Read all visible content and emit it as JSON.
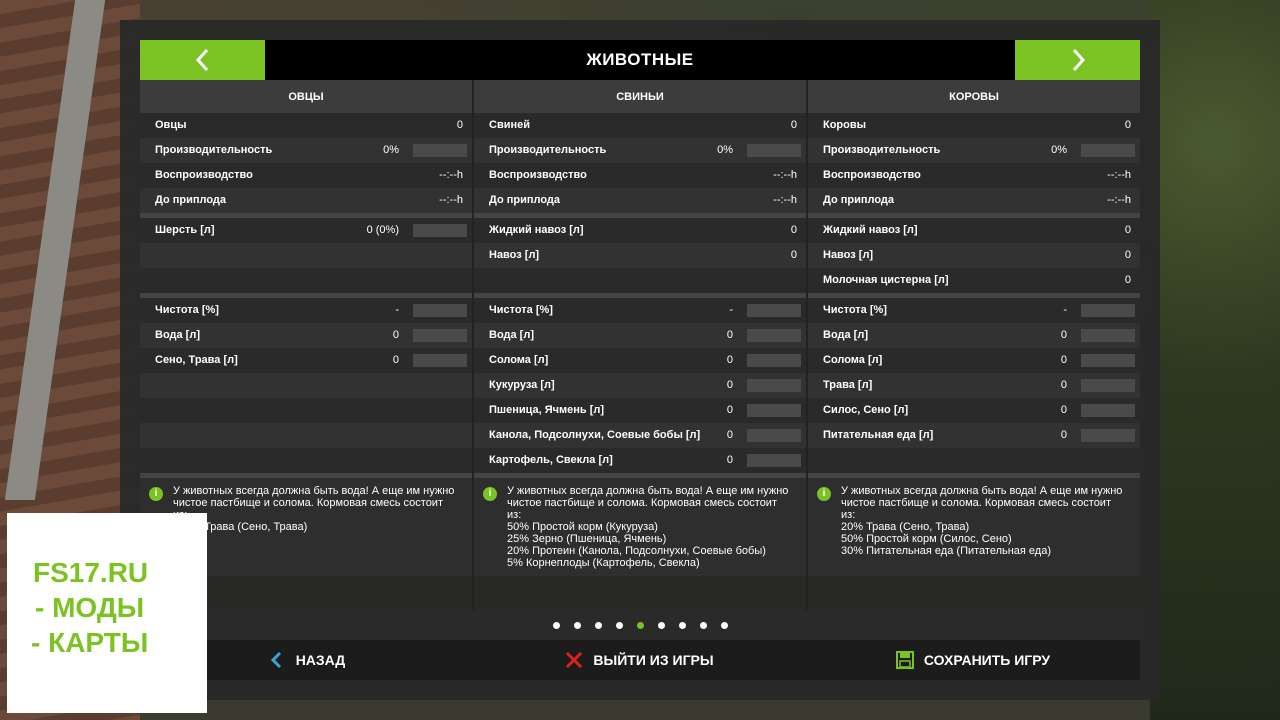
{
  "header": {
    "title": "ЖИВОТНЫЕ"
  },
  "columns": [
    {
      "name": "ОВЦЫ",
      "stats": [
        {
          "label": "Овцы",
          "value": "0"
        },
        {
          "label": "Производительность",
          "value": "0%"
        },
        {
          "label": "Воспроизводство",
          "value": "--:--h"
        },
        {
          "label": "До приплода",
          "value": "--:--h"
        }
      ],
      "products": [
        {
          "label": "Шерсть [л]",
          "value": "0 (0%)"
        }
      ],
      "needs": [
        {
          "label": "Чистота [%]",
          "value": "-"
        },
        {
          "label": "Вода [л]",
          "value": "0"
        },
        {
          "label": "Сено, Трава [л]",
          "value": "0"
        }
      ],
      "note": [
        "У животных всегда должна быть вода! А еще им нужно",
        "чистое пастбище и солома. Кормовая смесь состоит",
        "из:",
        "100% Трава (Сено, Трава)"
      ]
    },
    {
      "name": "СВИНЬИ",
      "stats": [
        {
          "label": "Свиней",
          "value": "0"
        },
        {
          "label": "Производительность",
          "value": "0%"
        },
        {
          "label": "Воспроизводство",
          "value": "--:--h"
        },
        {
          "label": "До приплода",
          "value": "--:--h"
        }
      ],
      "products": [
        {
          "label": "Жидкий навоз [л]",
          "value": "0"
        },
        {
          "label": "Навоз [л]",
          "value": "0"
        }
      ],
      "needs": [
        {
          "label": "Чистота [%]",
          "value": "-"
        },
        {
          "label": "Вода [л]",
          "value": "0"
        },
        {
          "label": "Солома [л]",
          "value": "0"
        },
        {
          "label": "Кукуруза [л]",
          "value": "0"
        },
        {
          "label": "Пшеница, Ячмень [л]",
          "value": "0"
        },
        {
          "label": "Канола, Подсолнухи, Соевые бобы [л]",
          "value": "0"
        },
        {
          "label": "Картофель, Свекла [л]",
          "value": "0"
        }
      ],
      "note": [
        "У животных всегда должна быть вода! А еще им нужно",
        "чистое пастбище и солома. Кормовая смесь состоит",
        "из:",
        "50% Простой корм (Кукуруза)",
        "25% Зерно (Пшеница, Ячмень)",
        "20% Протеин (Канола, Подсолнухи, Соевые бобы)",
        "5% Корнеплоды (Картофель, Свекла)"
      ]
    },
    {
      "name": "КОРОВЫ",
      "stats": [
        {
          "label": "Коровы",
          "value": "0"
        },
        {
          "label": "Производительность",
          "value": "0%"
        },
        {
          "label": "Воспроизводство",
          "value": "--:--h"
        },
        {
          "label": "До приплода",
          "value": "--:--h"
        }
      ],
      "products": [
        {
          "label": "Жидкий навоз [л]",
          "value": "0"
        },
        {
          "label": "Навоз [л]",
          "value": "0"
        },
        {
          "label": "Молочная цистерна [л]",
          "value": "0"
        }
      ],
      "needs": [
        {
          "label": "Чистота [%]",
          "value": "-"
        },
        {
          "label": "Вода [л]",
          "value": "0"
        },
        {
          "label": "Солома [л]",
          "value": "0"
        },
        {
          "label": "Трава [л]",
          "value": "0"
        },
        {
          "label": "Силос, Сено [л]",
          "value": "0"
        },
        {
          "label": "Питательная еда [л]",
          "value": "0"
        }
      ],
      "note": [
        "У животных всегда должна быть вода! А еще им нужно",
        "чистое пастбище и солома. Кормовая смесь состоит",
        "из:",
        "20% Трава (Сено, Трава)",
        "50% Простой корм (Силос, Сено)",
        "30% Питательная еда (Питательная еда)"
      ]
    }
  ],
  "pagination": {
    "count": 9,
    "active": 5
  },
  "footer": {
    "back": "НАЗАД",
    "quit": "ВЫЙТИ ИЗ ИГРЫ",
    "save": "СОХРАНИТЬ ИГРУ"
  },
  "watermark": {
    "lines": [
      "FS17.RU",
      "- МОДЫ",
      "- КАРТЫ"
    ]
  },
  "colors": {
    "accent": "#7bc223",
    "back_icon": "#3aa3d8",
    "quit_icon": "#e02020"
  }
}
